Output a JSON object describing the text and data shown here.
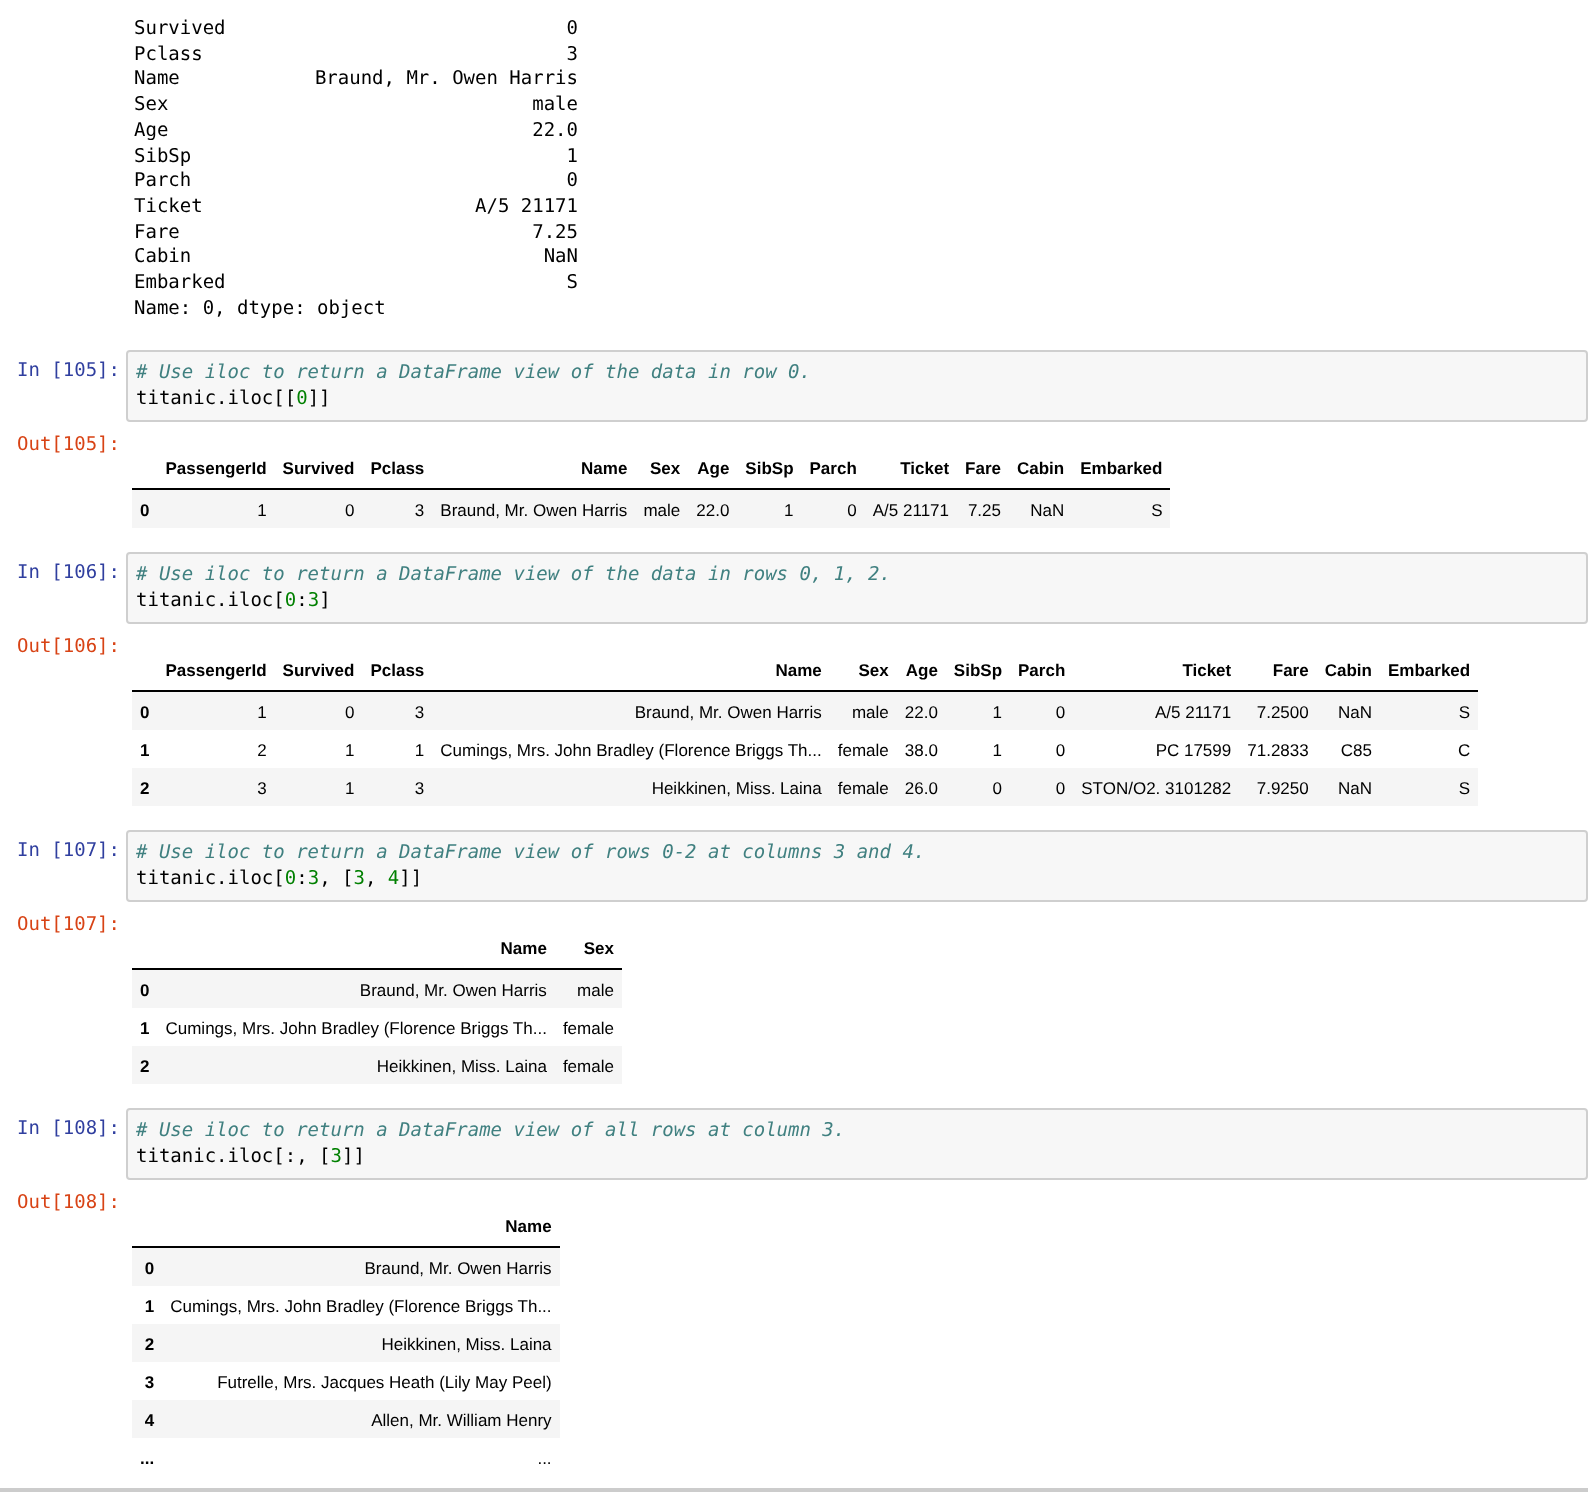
{
  "series_output": {
    "rows": [
      [
        "Survived",
        "0"
      ],
      [
        "Pclass",
        "3"
      ],
      [
        "Name",
        "Braund, Mr. Owen Harris"
      ],
      [
        "Sex",
        "male"
      ],
      [
        "Age",
        "22.0"
      ],
      [
        "SibSp",
        "1"
      ],
      [
        "Parch",
        "0"
      ],
      [
        "Ticket",
        "A/5 21171"
      ],
      [
        "Fare",
        "7.25"
      ],
      [
        "Cabin",
        "NaN"
      ],
      [
        "Embarked",
        "S"
      ]
    ],
    "footer": "Name: 0, dtype: object"
  },
  "cells": [
    {
      "in_prompt": "In [105]:",
      "code": [
        [
          {
            "kind": "comment",
            "text": "# Use iloc to return a DataFrame view of the data in row 0."
          }
        ],
        [
          {
            "kind": "text",
            "text": "titanic.iloc[["
          },
          {
            "kind": "number",
            "text": "0"
          },
          {
            "kind": "text",
            "text": "]]"
          }
        ]
      ],
      "out_prompt": "Out[105]:",
      "table": {
        "columns": [
          "PassengerId",
          "Survived",
          "Pclass",
          "Name",
          "Sex",
          "Age",
          "SibSp",
          "Parch",
          "Ticket",
          "Fare",
          "Cabin",
          "Embarked"
        ],
        "rows": [
          {
            "index": "0",
            "cells": [
              "1",
              "0",
              "3",
              "Braund, Mr. Owen Harris",
              "male",
              "22.0",
              "1",
              "0",
              "A/5 21171",
              "7.25",
              "NaN",
              "S"
            ]
          }
        ]
      }
    },
    {
      "in_prompt": "In [106]:",
      "code": [
        [
          {
            "kind": "comment",
            "text": "# Use iloc to return a DataFrame view of the data in rows 0, 1, 2."
          }
        ],
        [
          {
            "kind": "text",
            "text": "titanic.iloc["
          },
          {
            "kind": "number",
            "text": "0"
          },
          {
            "kind": "text",
            "text": ":"
          },
          {
            "kind": "number",
            "text": "3"
          },
          {
            "kind": "text",
            "text": "]"
          }
        ]
      ],
      "out_prompt": "Out[106]:",
      "table": {
        "columns": [
          "PassengerId",
          "Survived",
          "Pclass",
          "Name",
          "Sex",
          "Age",
          "SibSp",
          "Parch",
          "Ticket",
          "Fare",
          "Cabin",
          "Embarked"
        ],
        "rows": [
          {
            "index": "0",
            "cells": [
              "1",
              "0",
              "3",
              "Braund, Mr. Owen Harris",
              "male",
              "22.0",
              "1",
              "0",
              "A/5 21171",
              "7.2500",
              "NaN",
              "S"
            ]
          },
          {
            "index": "1",
            "cells": [
              "2",
              "1",
              "1",
              "Cumings, Mrs. John Bradley (Florence Briggs Th...",
              "female",
              "38.0",
              "1",
              "0",
              "PC 17599",
              "71.2833",
              "C85",
              "C"
            ]
          },
          {
            "index": "2",
            "cells": [
              "3",
              "1",
              "3",
              "Heikkinen, Miss. Laina",
              "female",
              "26.0",
              "0",
              "0",
              "STON/O2. 3101282",
              "7.9250",
              "NaN",
              "S"
            ]
          }
        ]
      }
    },
    {
      "in_prompt": "In [107]:",
      "code": [
        [
          {
            "kind": "comment",
            "text": "# Use iloc to return a DataFrame view of rows 0-2 at columns 3 and 4."
          }
        ],
        [
          {
            "kind": "text",
            "text": "titanic.iloc["
          },
          {
            "kind": "number",
            "text": "0"
          },
          {
            "kind": "text",
            "text": ":"
          },
          {
            "kind": "number",
            "text": "3"
          },
          {
            "kind": "text",
            "text": ", ["
          },
          {
            "kind": "number",
            "text": "3"
          },
          {
            "kind": "text",
            "text": ", "
          },
          {
            "kind": "number",
            "text": "4"
          },
          {
            "kind": "text",
            "text": "]]"
          }
        ]
      ],
      "out_prompt": "Out[107]:",
      "table": {
        "columns": [
          "Name",
          "Sex"
        ],
        "rows": [
          {
            "index": "0",
            "cells": [
              "Braund, Mr. Owen Harris",
              "male"
            ]
          },
          {
            "index": "1",
            "cells": [
              "Cumings, Mrs. John Bradley (Florence Briggs Th...",
              "female"
            ]
          },
          {
            "index": "2",
            "cells": [
              "Heikkinen, Miss. Laina",
              "female"
            ]
          }
        ]
      }
    },
    {
      "in_prompt": "In [108]:",
      "code": [
        [
          {
            "kind": "comment",
            "text": "# Use iloc to return a DataFrame view of all rows at column 3."
          }
        ],
        [
          {
            "kind": "text",
            "text": "titanic.iloc[:, ["
          },
          {
            "kind": "number",
            "text": "3"
          },
          {
            "kind": "text",
            "text": "]]"
          }
        ]
      ],
      "out_prompt": "Out[108]:",
      "table": {
        "columns": [
          "Name"
        ],
        "rows": [
          {
            "index": "0",
            "cells": [
              "Braund, Mr. Owen Harris"
            ]
          },
          {
            "index": "1",
            "cells": [
              "Cumings, Mrs. John Bradley (Florence Briggs Th..."
            ]
          },
          {
            "index": "2",
            "cells": [
              "Heikkinen, Miss. Laina"
            ]
          },
          {
            "index": "3",
            "cells": [
              "Futrelle, Mrs. Jacques Heath (Lily May Peel)"
            ]
          },
          {
            "index": "4",
            "cells": [
              "Allen, Mr. William Henry"
            ]
          },
          {
            "index": "...",
            "cells": [
              "..."
            ]
          }
        ]
      }
    }
  ]
}
